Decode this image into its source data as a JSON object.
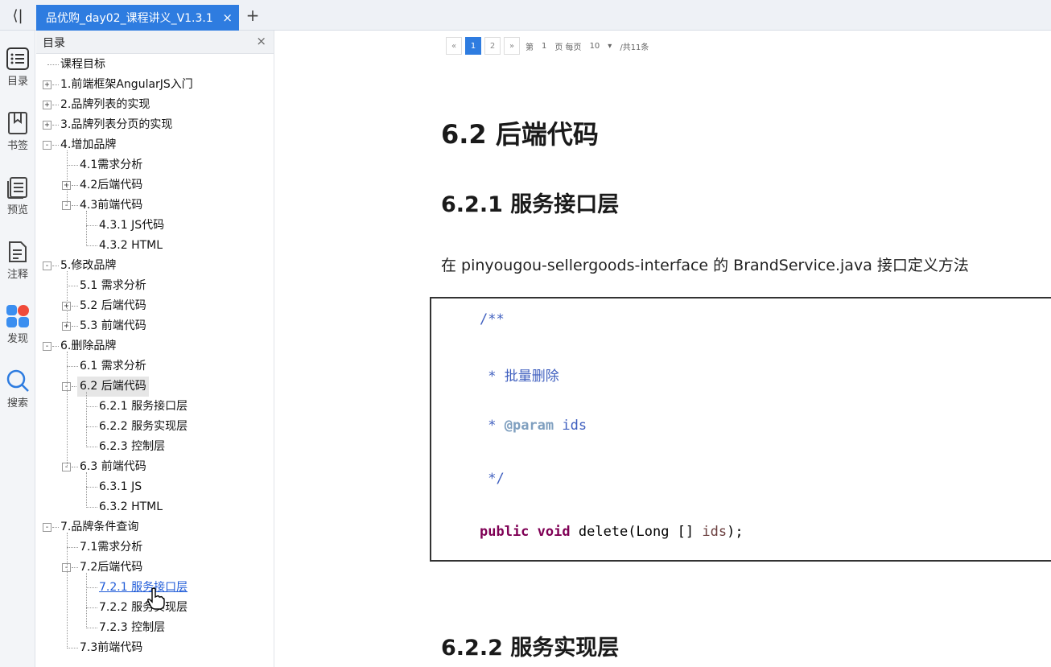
{
  "tabbar": {
    "collapse_icon": "⟨|",
    "tab_title": "品优购_day02_课程讲义_V1.3.1",
    "tab_close": "×",
    "add": "+"
  },
  "rail": {
    "items": [
      {
        "label": "目录",
        "icon": "list-icon"
      },
      {
        "label": "书签",
        "icon": "bookmark-icon"
      },
      {
        "label": "预览",
        "icon": "preview-icon"
      },
      {
        "label": "注释",
        "icon": "annotation-icon"
      },
      {
        "label": "发现",
        "icon": "discover-icon"
      },
      {
        "label": "搜索",
        "icon": "search-icon"
      }
    ]
  },
  "toc": {
    "title": "目录",
    "close": "×",
    "items": [
      {
        "label": "课程目标",
        "level": 0,
        "toggle": ""
      },
      {
        "label": "1.前端框架AngularJS入门",
        "level": 0,
        "toggle": "+"
      },
      {
        "label": "2.品牌列表的实现",
        "level": 0,
        "toggle": "+"
      },
      {
        "label": "3.品牌列表分页的实现",
        "level": 0,
        "toggle": "+"
      },
      {
        "label": "4.增加品牌",
        "level": 0,
        "toggle": "-"
      },
      {
        "label": "4.1需求分析",
        "level": 1,
        "toggle": ""
      },
      {
        "label": "4.2后端代码",
        "level": 1,
        "toggle": "+"
      },
      {
        "label": "4.3前端代码",
        "level": 1,
        "toggle": "-"
      },
      {
        "label": "4.3.1 JS代码",
        "level": 2,
        "toggle": ""
      },
      {
        "label": "4.3.2 HTML",
        "level": 2,
        "toggle": ""
      },
      {
        "label": "5.修改品牌",
        "level": 0,
        "toggle": "-"
      },
      {
        "label": "5.1 需求分析",
        "level": 1,
        "toggle": ""
      },
      {
        "label": "5.2 后端代码",
        "level": 1,
        "toggle": "+"
      },
      {
        "label": "5.3 前端代码",
        "level": 1,
        "toggle": "+"
      },
      {
        "label": "6.删除品牌",
        "level": 0,
        "toggle": "-"
      },
      {
        "label": "6.1 需求分析",
        "level": 1,
        "toggle": ""
      },
      {
        "label": "6.2 后端代码",
        "level": 1,
        "toggle": "-",
        "highlight": true
      },
      {
        "label": "6.2.1 服务接口层",
        "level": 2,
        "toggle": ""
      },
      {
        "label": "6.2.2 服务实现层",
        "level": 2,
        "toggle": ""
      },
      {
        "label": "6.2.3 控制层",
        "level": 2,
        "toggle": ""
      },
      {
        "label": "6.3 前端代码",
        "level": 1,
        "toggle": "-"
      },
      {
        "label": "6.3.1 JS",
        "level": 2,
        "toggle": ""
      },
      {
        "label": "6.3.2 HTML",
        "level": 2,
        "toggle": ""
      },
      {
        "label": "7.品牌条件查询",
        "level": 0,
        "toggle": "-"
      },
      {
        "label": "7.1需求分析",
        "level": 1,
        "toggle": ""
      },
      {
        "label": "7.2后端代码",
        "level": 1,
        "toggle": "-"
      },
      {
        "label": "7.2.1 服务接口层",
        "level": 2,
        "toggle": "",
        "link": true
      },
      {
        "label": "7.2.2 服务实现层",
        "level": 2,
        "toggle": ""
      },
      {
        "label": "7.2.3 控制层",
        "level": 2,
        "toggle": ""
      },
      {
        "label": "7.3前端代码",
        "level": 1,
        "toggle": ""
      }
    ]
  },
  "pager": {
    "prev": "«",
    "pages": [
      "1",
      "2"
    ],
    "next": "»",
    "page_prefix": "第",
    "page_value": "1",
    "page_suffix": "页 每页",
    "per_page": "10",
    "total": "/共11条"
  },
  "doc": {
    "h2": "6.2  后端代码",
    "h3_1": "6.2.1  服务接口层",
    "para": "在 pinyougou-sellergoods-interface 的 BrandService.java 接口定义方法",
    "code": {
      "l1": "/**",
      "l2": " * 批量删除",
      "l3_star": " * ",
      "l3_tag": "@param",
      "l3_rest": " ids",
      "l4": " */",
      "l5_kw1": "public",
      "l5_kw2": "void",
      "l5_rest": " delete(Long [] ",
      "l5_param": "ids",
      "l5_end": ");"
    },
    "h3_2": "6.2.2  服务实现层"
  },
  "colors": {
    "accent": "#2e7ce0",
    "link": "#1f5bd8",
    "comment": "#3f5fbf",
    "keyword": "#7f0055"
  }
}
